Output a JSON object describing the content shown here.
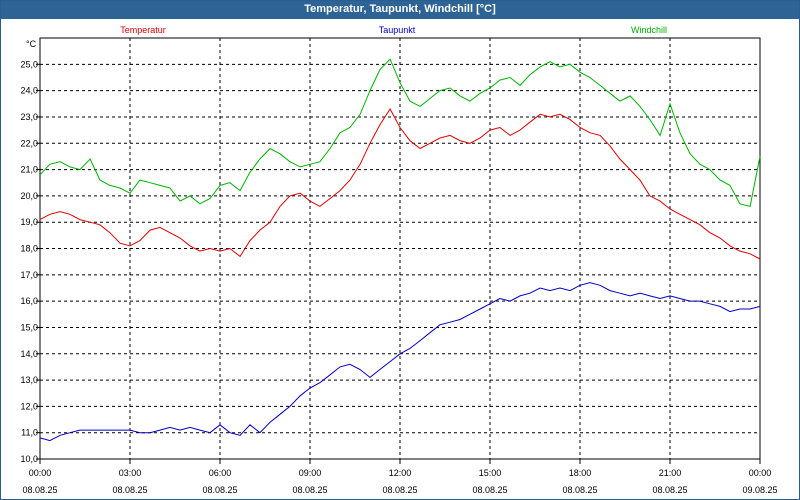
{
  "window": {
    "title": "Temperatur, Taupunkt, Windchill [°C]"
  },
  "chart_data": {
    "type": "line",
    "title": "Temperatur, Taupunkt, Windchill [°C]",
    "ylabel": "°C",
    "xlabel": "",
    "ylim": [
      10.0,
      26.0
    ],
    "xlim": [
      0,
      24
    ],
    "grid": true,
    "legend_placement": "top",
    "y_ticks": [
      "10,0",
      "11,0",
      "12,0",
      "13,0",
      "14,0",
      "15,0",
      "16,0",
      "17,0",
      "18,0",
      "19,0",
      "20,0",
      "21,0",
      "22,0",
      "23,0",
      "24,0",
      "25,0"
    ],
    "x_ticks": [
      {
        "time": "00:00",
        "date": "08.08.25"
      },
      {
        "time": "03:00",
        "date": "08.08.25"
      },
      {
        "time": "06:00",
        "date": "08.08.25"
      },
      {
        "time": "09:00",
        "date": "08.08.25"
      },
      {
        "time": "12:00",
        "date": "08.08.25"
      },
      {
        "time": "15:00",
        "date": "08.08.25"
      },
      {
        "time": "18:00",
        "date": "08.08.25"
      },
      {
        "time": "21:00",
        "date": "08.08.25"
      },
      {
        "time": "00:00",
        "date": "09.08.25"
      }
    ],
    "series": [
      {
        "name": "Temperatur",
        "color": "#e00000",
        "x": [
          0,
          0.33,
          0.67,
          1,
          1.33,
          1.67,
          2,
          2.33,
          2.67,
          3,
          3.33,
          3.67,
          4,
          4.33,
          4.67,
          5,
          5.33,
          5.67,
          6,
          6.33,
          6.67,
          7,
          7.33,
          7.67,
          8,
          8.33,
          8.67,
          9,
          9.33,
          9.67,
          10,
          10.33,
          10.67,
          11,
          11.33,
          11.67,
          12,
          12.33,
          12.67,
          13,
          13.33,
          13.67,
          14,
          14.33,
          14.67,
          15,
          15.33,
          15.67,
          16,
          16.33,
          16.67,
          17,
          17.33,
          17.67,
          18,
          18.33,
          18.67,
          19,
          19.33,
          19.67,
          20,
          20.33,
          20.67,
          21,
          21.33,
          21.67,
          22,
          22.33,
          22.67,
          23,
          23.33,
          23.67,
          24
        ],
        "values": [
          19.1,
          19.3,
          19.4,
          19.3,
          19.1,
          19.0,
          18.9,
          18.6,
          18.2,
          18.1,
          18.3,
          18.7,
          18.8,
          18.6,
          18.4,
          18.1,
          17.9,
          18.0,
          17.9,
          18.0,
          17.7,
          18.3,
          18.7,
          19.0,
          19.6,
          20.0,
          20.1,
          19.8,
          19.6,
          19.9,
          20.2,
          20.6,
          21.2,
          22.0,
          22.7,
          23.3,
          22.6,
          22.1,
          21.8,
          22.0,
          22.2,
          22.3,
          22.1,
          22.0,
          22.2,
          22.5,
          22.6,
          22.3,
          22.5,
          22.8,
          23.1,
          23.0,
          23.1,
          22.9,
          22.6,
          22.4,
          22.3,
          21.9,
          21.4,
          21.0,
          20.6,
          20.0,
          19.8,
          19.5,
          19.3,
          19.1,
          18.9,
          18.6,
          18.4,
          18.1,
          17.9,
          17.8,
          17.6
        ]
      },
      {
        "name": "Taupunkt",
        "color": "#0000c8",
        "x": [
          0,
          0.33,
          0.67,
          1,
          1.33,
          1.67,
          2,
          2.33,
          2.67,
          3,
          3.33,
          3.67,
          4,
          4.33,
          4.67,
          5,
          5.33,
          5.67,
          6,
          6.33,
          6.67,
          7,
          7.33,
          7.67,
          8,
          8.33,
          8.67,
          9,
          9.33,
          9.67,
          10,
          10.33,
          10.67,
          11,
          11.33,
          11.67,
          12,
          12.33,
          12.67,
          13,
          13.33,
          13.67,
          14,
          14.33,
          14.67,
          15,
          15.33,
          15.67,
          16,
          16.33,
          16.67,
          17,
          17.33,
          17.67,
          18,
          18.33,
          18.67,
          19,
          19.33,
          19.67,
          20,
          20.33,
          20.67,
          21,
          21.33,
          21.67,
          22,
          22.33,
          22.67,
          23,
          23.33,
          23.67,
          24
        ],
        "values": [
          10.8,
          10.7,
          10.9,
          11.0,
          11.1,
          11.1,
          11.1,
          11.1,
          11.1,
          11.1,
          11.0,
          11.0,
          11.1,
          11.2,
          11.1,
          11.2,
          11.1,
          11.0,
          11.3,
          11.0,
          10.9,
          11.3,
          11.0,
          11.4,
          11.7,
          12.0,
          12.4,
          12.7,
          12.9,
          13.2,
          13.5,
          13.6,
          13.4,
          13.1,
          13.4,
          13.7,
          14.0,
          14.2,
          14.5,
          14.8,
          15.1,
          15.2,
          15.3,
          15.5,
          15.7,
          15.9,
          16.1,
          16.0,
          16.2,
          16.3,
          16.5,
          16.4,
          16.5,
          16.4,
          16.6,
          16.7,
          16.6,
          16.4,
          16.3,
          16.2,
          16.3,
          16.2,
          16.1,
          16.2,
          16.1,
          16.0,
          16.0,
          15.9,
          15.8,
          15.6,
          15.7,
          15.7,
          15.8
        ]
      },
      {
        "name": "Windchill",
        "color": "#00b400",
        "x": [
          0,
          0.33,
          0.67,
          1,
          1.33,
          1.67,
          2,
          2.33,
          2.67,
          3,
          3.33,
          3.67,
          4,
          4.33,
          4.67,
          5,
          5.33,
          5.67,
          6,
          6.33,
          6.67,
          7,
          7.33,
          7.67,
          8,
          8.33,
          8.67,
          9,
          9.33,
          9.67,
          10,
          10.33,
          10.67,
          11,
          11.33,
          11.67,
          12,
          12.33,
          12.67,
          13,
          13.33,
          13.67,
          14,
          14.33,
          14.67,
          15,
          15.33,
          15.67,
          16,
          16.33,
          16.67,
          17,
          17.33,
          17.67,
          18,
          18.33,
          18.67,
          19,
          19.33,
          19.67,
          20,
          20.33,
          20.67,
          21,
          21.33,
          21.67,
          22,
          22.33,
          22.67,
          23,
          23.33,
          23.67,
          24
        ],
        "values": [
          20.8,
          21.2,
          21.3,
          21.1,
          21.0,
          21.4,
          20.6,
          20.4,
          20.3,
          20.1,
          20.6,
          20.5,
          20.4,
          20.3,
          19.8,
          20.0,
          19.7,
          19.9,
          20.4,
          20.5,
          20.2,
          20.9,
          21.4,
          21.8,
          21.6,
          21.3,
          21.1,
          21.2,
          21.3,
          21.8,
          22.4,
          22.6,
          23.1,
          24.0,
          24.8,
          25.2,
          24.3,
          23.6,
          23.4,
          23.7,
          24.0,
          24.1,
          23.8,
          23.6,
          23.9,
          24.1,
          24.4,
          24.5,
          24.2,
          24.6,
          24.9,
          25.1,
          24.9,
          25.0,
          24.7,
          24.5,
          24.2,
          23.9,
          23.6,
          23.8,
          23.4,
          22.9,
          22.3,
          23.5,
          22.4,
          21.6,
          21.2,
          21.0,
          20.6,
          20.4,
          19.7,
          19.6,
          21.5
        ]
      }
    ]
  }
}
